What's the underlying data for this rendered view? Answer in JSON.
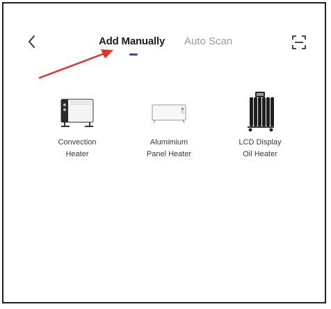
{
  "header": {
    "tabs": [
      {
        "label": "Add Manually",
        "active": true
      },
      {
        "label": "Auto Scan",
        "active": false
      }
    ]
  },
  "icons": {
    "back": "chevron-left-icon",
    "scan": "scan-frame-icon"
  },
  "devices": [
    {
      "line1": "Convection",
      "line2": "Heater",
      "icon": "convection-heater-icon"
    },
    {
      "line1": "Alumimium",
      "line2": "Panel Heater",
      "icon": "panel-heater-icon"
    },
    {
      "line1": "LCD Display",
      "line2": "Oil Heater",
      "icon": "oil-heater-icon"
    }
  ],
  "colors": {
    "active_tab": "#1b1b1b",
    "inactive_tab": "#9a9a9a",
    "tab_indicator": "#2b4fb0",
    "annotation_arrow": "#e2302a"
  }
}
